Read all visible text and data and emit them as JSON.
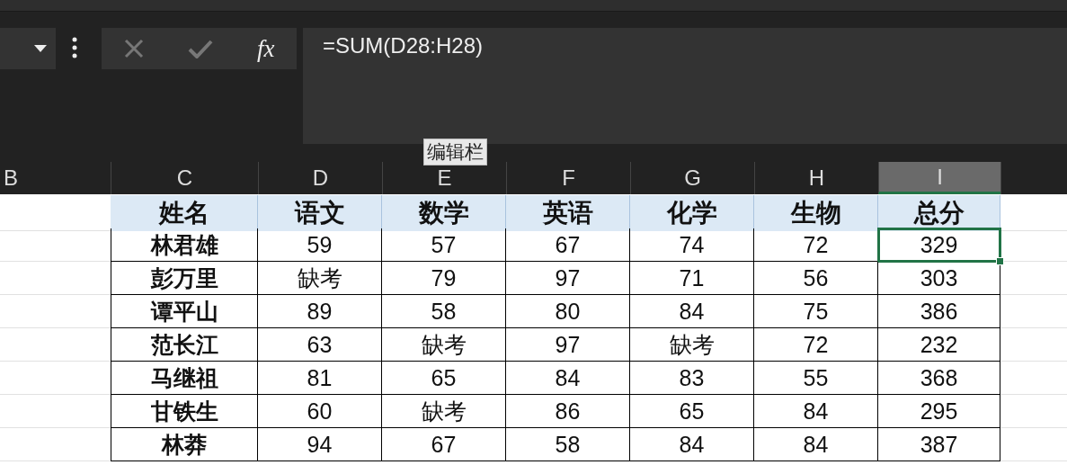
{
  "formula_bar": {
    "function_button": "fx",
    "formula": "=SUM(D28:H28)",
    "tooltip": "编辑栏"
  },
  "columns": [
    {
      "label": "B",
      "selected": false
    },
    {
      "label": "C",
      "selected": false
    },
    {
      "label": "D",
      "selected": false
    },
    {
      "label": "E",
      "selected": false
    },
    {
      "label": "F",
      "selected": false
    },
    {
      "label": "G",
      "selected": false
    },
    {
      "label": "H",
      "selected": false
    },
    {
      "label": "I",
      "selected": true
    }
  ],
  "table": {
    "headers": [
      "姓名",
      "语文",
      "数学",
      "英语",
      "化学",
      "生物",
      "总分"
    ],
    "rows": [
      {
        "name": "林君雄",
        "scores": [
          "59",
          "57",
          "67",
          "74",
          "72"
        ],
        "total": "329",
        "total_selected": true
      },
      {
        "name": "彭万里",
        "scores": [
          "缺考",
          "79",
          "97",
          "71",
          "56"
        ],
        "total": "303",
        "total_selected": false
      },
      {
        "name": "谭平山",
        "scores": [
          "89",
          "58",
          "80",
          "84",
          "75"
        ],
        "total": "386",
        "total_selected": false
      },
      {
        "name": "范长江",
        "scores": [
          "63",
          "缺考",
          "97",
          "缺考",
          "72"
        ],
        "total": "232",
        "total_selected": false
      },
      {
        "name": "马继祖",
        "scores": [
          "81",
          "65",
          "84",
          "83",
          "55"
        ],
        "total": "368",
        "total_selected": false
      },
      {
        "name": "甘铁生",
        "scores": [
          "60",
          "缺考",
          "86",
          "65",
          "84"
        ],
        "total": "295",
        "total_selected": false
      },
      {
        "name": "林莽",
        "scores": [
          "94",
          "67",
          "58",
          "84",
          "84"
        ],
        "total": "387",
        "total_selected": false
      }
    ]
  }
}
